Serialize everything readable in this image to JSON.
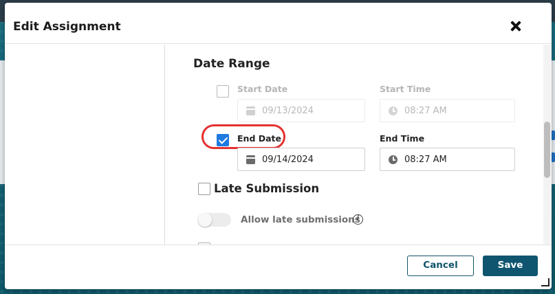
{
  "modal": {
    "title": "Edit Assignment",
    "close_icon": "close-icon"
  },
  "date_range": {
    "title": "Date Range",
    "start_date": {
      "label": "Start Date",
      "checked": false,
      "value": "09/13/2024",
      "icon": "calendar-icon"
    },
    "start_time": {
      "label": "Start Time",
      "value": "08:27 AM",
      "icon": "clock-icon"
    },
    "end_date": {
      "label": "End Date",
      "checked": true,
      "value": "09/14/2024",
      "icon": "calendar-icon"
    },
    "end_time": {
      "label": "End Time",
      "value": "08:27 AM",
      "icon": "clock-icon"
    },
    "highlight_color": "#e53030"
  },
  "late_submission": {
    "title": "Late Submission",
    "checked": false,
    "toggle_label": "Allow late submissions",
    "toggle_on": false,
    "info_icon": "info-icon",
    "info_glyph": "i"
  },
  "footer": {
    "cancel_label": "Cancel",
    "save_label": "Save"
  },
  "colors": {
    "primary": "#0f5570",
    "checkbox_accent": "#1f7ae0"
  }
}
